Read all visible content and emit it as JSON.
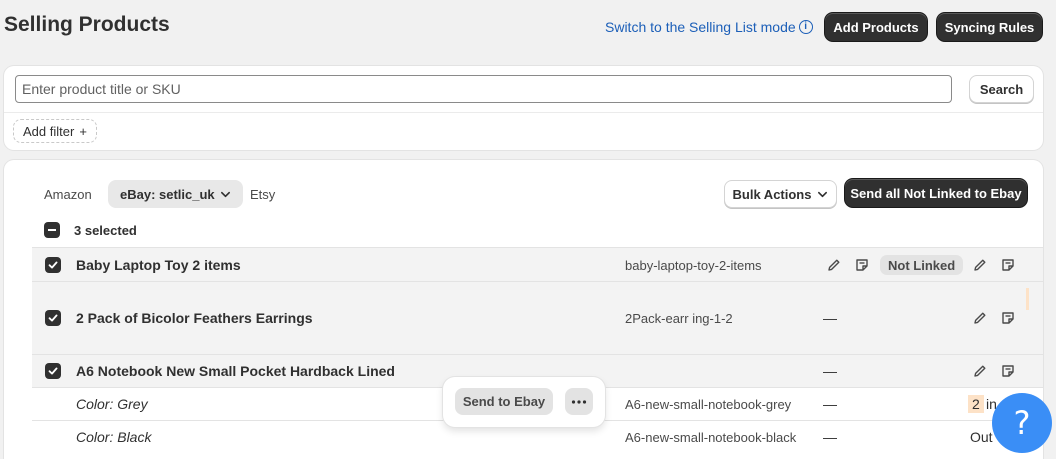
{
  "header": {
    "title": "Selling Products",
    "switch_link": "Switch to the Selling List mode",
    "add_products": "Add Products",
    "syncing_rules": "Syncing Rules"
  },
  "search": {
    "placeholder": "Enter product title or SKU",
    "button": "Search",
    "add_filter": "Add filter",
    "add_filter_icon": "+"
  },
  "tabs": [
    {
      "label": "Amazon",
      "active": false
    },
    {
      "label": "eBay: setlic_uk",
      "active": true
    },
    {
      "label": "Etsy",
      "active": false
    }
  ],
  "toolbar": {
    "bulk_actions": "Bulk Actions",
    "send_all": "Send all Not Linked to Ebay"
  },
  "selection": {
    "count_label": "3 selected"
  },
  "rows": [
    {
      "title": "Baby Laptop Toy 2 items",
      "sku": "baby-laptop-toy-2-items",
      "status": "Not Linked",
      "selected": true
    },
    {
      "title": "2 Pack of Bicolor Feathers Earrings",
      "sku": "2Pack-earr ing-1-2",
      "dash": "—",
      "selected": true
    },
    {
      "title": "A6 Notebook New Small Pocket Hardback Lined",
      "dash": "—",
      "selected": true,
      "variants": [
        {
          "label": "Color: Grey",
          "sku": "A6-new-small-notebook-grey",
          "dash": "—",
          "qty": "2",
          "qty_tail": "in"
        },
        {
          "label": "Color: Black",
          "sku": "A6-new-small-notebook-black",
          "dash": "—",
          "qty_tail": "Out"
        }
      ]
    }
  ],
  "popover": {
    "send": "Send to Ebay",
    "more": "•••"
  },
  "help": {
    "symbol": "?"
  },
  "colors": {
    "primary_dark": "#303030",
    "link": "#1c5fb8",
    "help_blue": "#3a8ef6",
    "qty_highlight": "#fde2c7"
  }
}
